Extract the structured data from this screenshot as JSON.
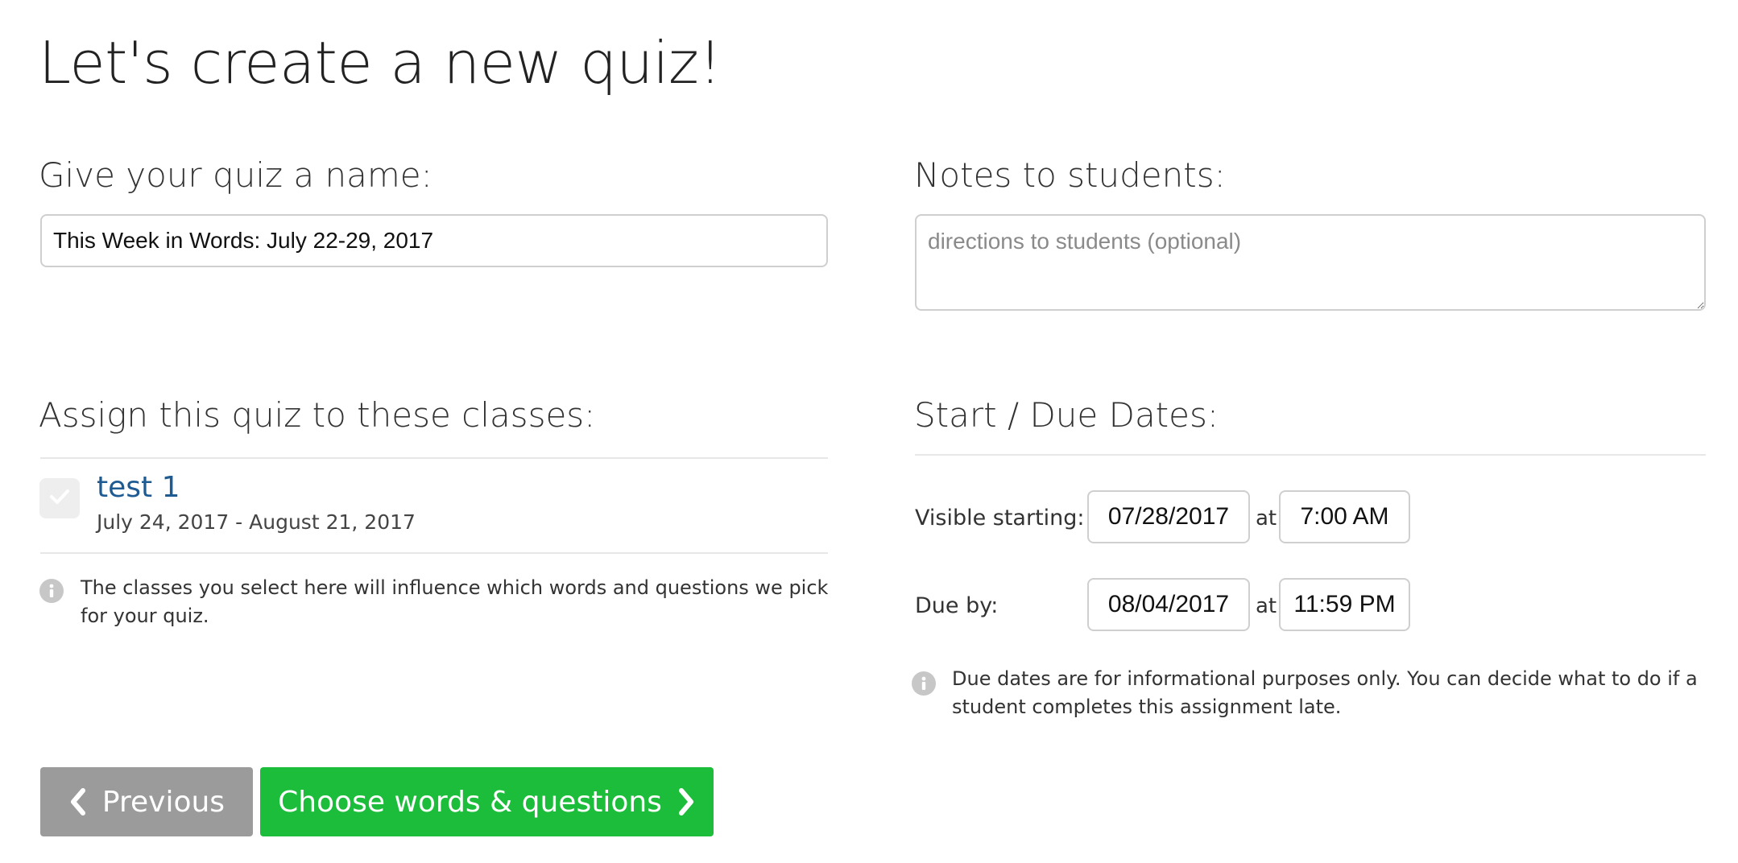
{
  "page": {
    "title": "Let's create a new quiz!"
  },
  "quiz_name": {
    "heading": "Give your quiz a name:",
    "value": "This Week in Words: July 22-29, 2017"
  },
  "notes": {
    "heading": "Notes to students:",
    "placeholder": "directions to students (optional)"
  },
  "classes": {
    "heading": "Assign this quiz to these classes:",
    "items": [
      {
        "name": "test 1",
        "dates": "July 24, 2017 - August 21, 2017",
        "checked": true
      }
    ],
    "info": "The classes you select here will influence which words and questions we pick for your quiz."
  },
  "dates": {
    "heading": "Start / Due Dates:",
    "visible_label": "Visible starting:",
    "visible_date": "07/28/2017",
    "visible_time": "7:00 AM",
    "due_label": "Due by:",
    "due_date": "08/04/2017",
    "due_time": "11:59 PM",
    "at": "at",
    "info": "Due dates are for informational purposes only. You can decide what to do if a student completes this assignment late."
  },
  "actions": {
    "previous_label": "Previous",
    "next_label": "Choose words & questions"
  },
  "colors": {
    "link": "#1e5b93",
    "primary_button": "#1cbd3b",
    "secondary_button": "#9b9b9b"
  },
  "icons": {
    "checkbox": "check-icon",
    "info": "info-icon",
    "previous": "chevron-left-icon",
    "next": "chevron-right-icon"
  }
}
